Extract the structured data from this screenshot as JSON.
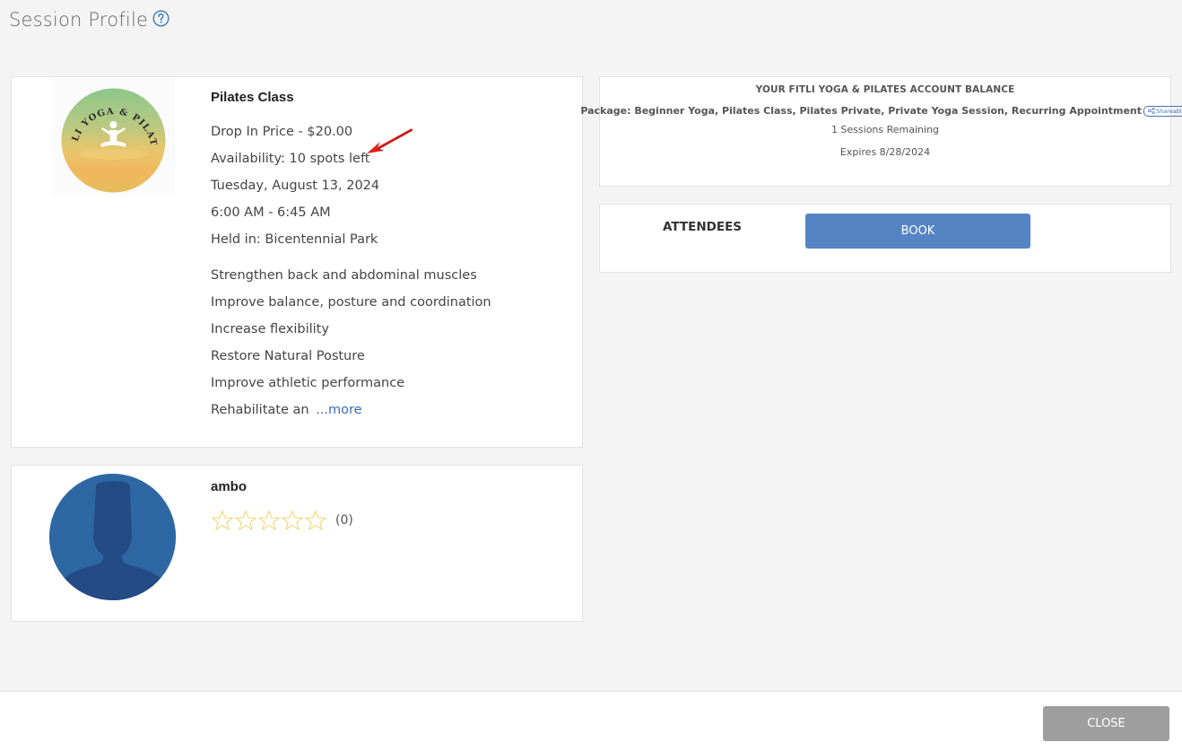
{
  "header": {
    "title": "Session Profile",
    "help_icon": "question-circle-icon"
  },
  "session": {
    "title": "Pilates Class",
    "logo_text": "FITLI YOGA & PILATES",
    "price": "Drop In Price - $20.00",
    "availability": "Availability: 10 spots left",
    "date": "Tuesday, August 13, 2024",
    "time": "6:00 AM - 6:45 AM",
    "location": "Held in: Bicentennial Park",
    "description": [
      "Strengthen back and abdominal muscles",
      "Improve balance, posture and coordination",
      "Increase flexibility",
      "Restore Natural Posture",
      "Improve athletic performance",
      "Rehabilitate an"
    ],
    "more_label": "...more"
  },
  "trainer": {
    "name": "ambo",
    "rating_stars": 0,
    "rating_max": 5,
    "rating_count": "(0)"
  },
  "balance": {
    "title": "YOUR FITLI YOGA & PILATES ACCOUNT BALANCE",
    "package": "Package: Beginner Yoga, Pilates Class, Pilates Private, Private Yoga Session, Recurring Appointment",
    "badge": "Shareable",
    "sessions_remaining": "1 Sessions Remaining",
    "expires": "Expires 8/28/2024"
  },
  "attendees": {
    "label": "ATTENDEES",
    "book_label": "BOOK"
  },
  "footer": {
    "close_label": "CLOSE"
  },
  "colors": {
    "accent": "#5584c5",
    "link": "#3a6db5",
    "close_button": "#9e9e9e",
    "star_outline": "#f2d36b",
    "arrow": "#e0201b"
  }
}
